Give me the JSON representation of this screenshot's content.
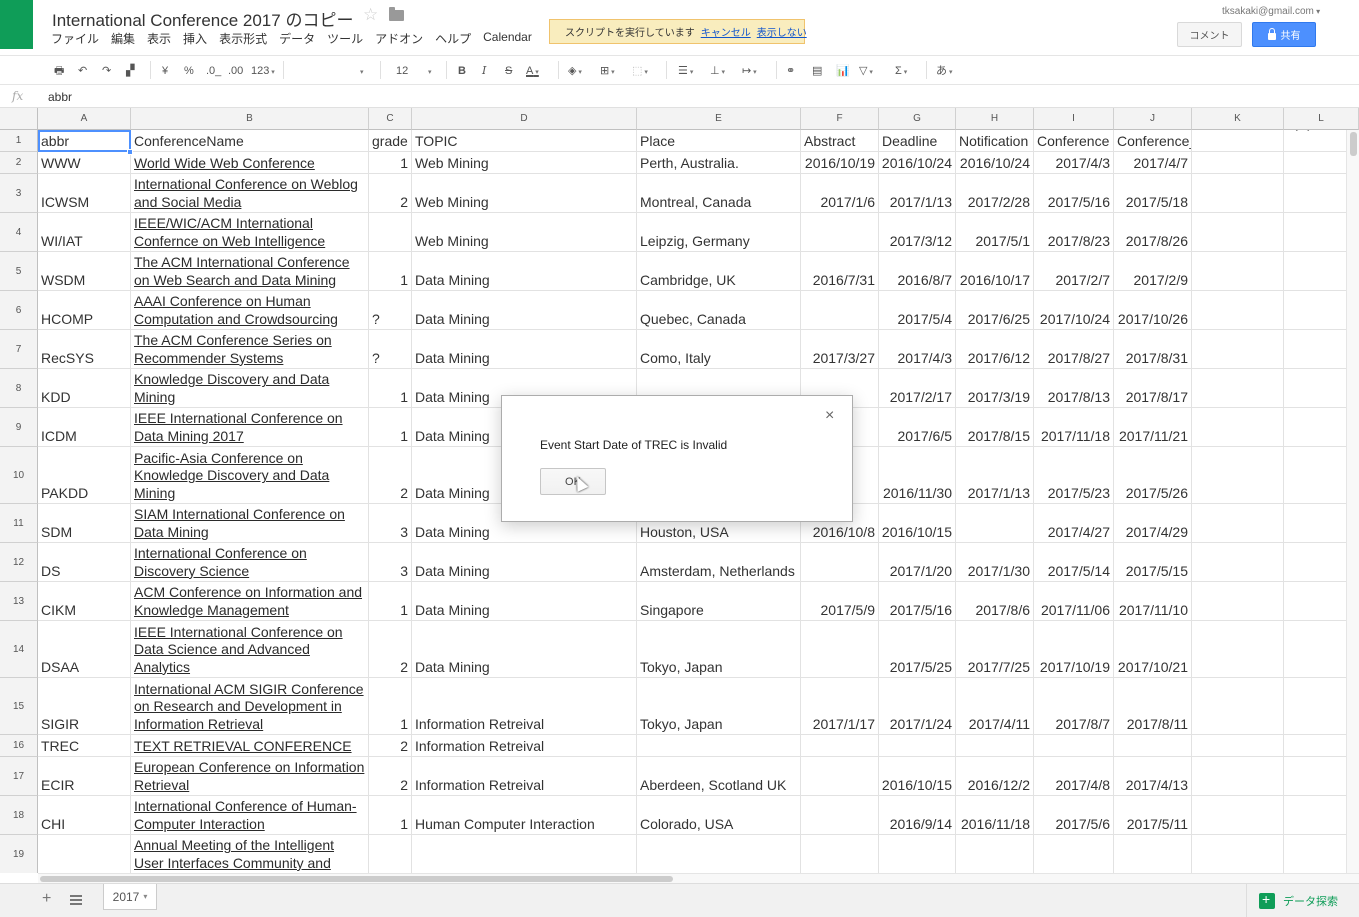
{
  "document": {
    "title": "International Conference 2017 のコピー",
    "user_email": "tksakaki@gmail.com"
  },
  "menu": [
    "ファイル",
    "編集",
    "表示",
    "挿入",
    "表示形式",
    "データ",
    "ツール",
    "アドオン",
    "ヘルプ",
    "Calendar"
  ],
  "banner": {
    "text": "スクリプトを実行しています",
    "cancel": "キャンセル",
    "hide": "表示しない"
  },
  "header_buttons": {
    "comment": "コメント",
    "share": "共有"
  },
  "toolbar": {
    "currency": "¥",
    "percent": "%",
    "dec_decrease": ".0_",
    "dec_increase": ".00",
    "format_more": "123",
    "font_size": "12",
    "bold": "B",
    "italic": "I",
    "strike": "S",
    "text_color": "A",
    "sigma": "Σ",
    "input_tools": "あ"
  },
  "formula": {
    "label": "fx",
    "value": "abbr"
  },
  "columns": [
    "A",
    "B",
    "C",
    "D",
    "E",
    "F",
    "G",
    "H",
    "I",
    "J",
    "K",
    "L"
  ],
  "rows": [
    {
      "num": "1",
      "abbr": "abbr",
      "name": "ConferenceName",
      "grade": "grade",
      "topic": "TOPIC",
      "place": "Place",
      "abstract": "Abstract",
      "deadline": "Deadline",
      "notification": "Notification",
      "conf": "Conference",
      "conf_end": "Conference_end"
    },
    {
      "num": "2",
      "abbr": "WWW",
      "name": "World Wide Web Conference",
      "grade": "1",
      "topic": "Web Mining",
      "place": "Perth, Australia.",
      "abstract": "2016/10/19",
      "deadline": "2016/10/24",
      "notification": "2016/10/24",
      "conf": "2017/4/3",
      "conf_end": "2017/4/7"
    },
    {
      "num": "3",
      "abbr": "ICWSM",
      "name": "International Conference on Weblog and Social Media",
      "grade": "2",
      "topic": "Web Mining",
      "place": "Montreal, Canada",
      "abstract": "2017/1/6",
      "deadline": "2017/1/13",
      "notification": "2017/2/28",
      "conf": "2017/5/16",
      "conf_end": "2017/5/18"
    },
    {
      "num": "4",
      "abbr": "WI/IAT",
      "name": "IEEE/WIC/ACM International Confernce on Web Intelligence",
      "grade": "",
      "topic": "Web Mining",
      "place": "Leipzig, Germany",
      "abstract": "",
      "deadline": "2017/3/12",
      "notification": "2017/5/1",
      "conf": "2017/8/23",
      "conf_end": "2017/8/26"
    },
    {
      "num": "5",
      "abbr": "WSDM",
      "name": "The ACM International Conference on Web Search and Data Mining",
      "grade": "1",
      "topic": "Data Mining",
      "place": "Cambridge, UK",
      "abstract": "2016/7/31",
      "deadline": "2016/8/7",
      "notification": "2016/10/17",
      "conf": "2017/2/7",
      "conf_end": "2017/2/9"
    },
    {
      "num": "6",
      "abbr": "HCOMP",
      "name": "AAAI Conference on Human Computation and Crowdsourcing",
      "grade": "?",
      "topic": "Data Mining",
      "place": "Quebec, Canada",
      "abstract": "",
      "deadline": "2017/5/4",
      "notification": "2017/6/25",
      "conf": "2017/10/24",
      "conf_end": "2017/10/26"
    },
    {
      "num": "7",
      "abbr": "RecSYS",
      "name": "The ACM Conference Series on Recommender Systems",
      "grade": "?",
      "topic": "Data Mining",
      "place": "Como, Italy",
      "abstract": "2017/3/27",
      "deadline": "2017/4/3",
      "notification": "2017/6/12",
      "conf": "2017/8/27",
      "conf_end": "2017/8/31"
    },
    {
      "num": "8",
      "abbr": "KDD",
      "name": "Knowledge Discovery and Data Mining",
      "grade": "1",
      "topic": "Data Mining",
      "place": "",
      "abstract": "",
      "deadline": "2017/2/17",
      "notification": "2017/3/19",
      "conf": "2017/8/13",
      "conf_end": "2017/8/17"
    },
    {
      "num": "9",
      "abbr": "ICDM",
      "name": "IEEE International Conference on Data Mining 2017",
      "grade": "1",
      "topic": "Data Mining",
      "place": "",
      "abstract": "",
      "deadline": "2017/6/5",
      "notification": "2017/8/15",
      "conf": "2017/11/18",
      "conf_end": "2017/11/21"
    },
    {
      "num": "10",
      "abbr": "PAKDD",
      "name": "Pacific-Asia Conference on Knowledge Discovery and Data Mining",
      "grade": "2",
      "topic": "Data Mining",
      "place": "",
      "abstract": "",
      "deadline": "2016/11/30",
      "notification": "2017/1/13",
      "conf": "2017/5/23",
      "conf_end": "2017/5/26"
    },
    {
      "num": "11",
      "abbr": "SDM",
      "name": "SIAM International Conference on Data Mining",
      "grade": "3",
      "topic": "Data Mining",
      "place": "Houston, USA",
      "abstract": "2016/10/8",
      "deadline": "2016/10/15",
      "notification": "",
      "conf": "2017/4/27",
      "conf_end": "2017/4/29"
    },
    {
      "num": "12",
      "abbr": "DS",
      "name": "International Conference on Discovery Science",
      "grade": "3",
      "topic": "Data Mining",
      "place": "Amsterdam, Netherlands",
      "abstract": "",
      "deadline": "2017/1/20",
      "notification": "2017/1/30",
      "conf": "2017/5/14",
      "conf_end": "2017/5/15"
    },
    {
      "num": "13",
      "abbr": "CIKM",
      "name": "ACM Conference on Information and Knowledge Management",
      "grade": "1",
      "topic": "Data Mining",
      "place": "Singapore",
      "abstract": "2017/5/9",
      "deadline": "2017/5/16",
      "notification": "2017/8/6",
      "conf": "2017/11/06",
      "conf_end": "2017/11/10"
    },
    {
      "num": "14",
      "abbr": "DSAA",
      "name": "IEEE International Conference on Data Science and Advanced Analytics",
      "grade": "2",
      "topic": "Data Mining",
      "place": "Tokyo, Japan",
      "abstract": "",
      "deadline": "2017/5/25",
      "notification": "2017/7/25",
      "conf": "2017/10/19",
      "conf_end": "2017/10/21"
    },
    {
      "num": "15",
      "abbr": "SIGIR",
      "name": "International ACM SIGIR Conference on Research and Development in Information Retrieval",
      "grade": "1",
      "topic": "Information Retreival",
      "place": "Tokyo, Japan",
      "abstract": "2017/1/17",
      "deadline": "2017/1/24",
      "notification": "2017/4/11",
      "conf": "2017/8/7",
      "conf_end": "2017/8/11"
    },
    {
      "num": "16",
      "abbr": "TREC",
      "name": "TEXT RETRIEVAL CONFERENCE",
      "grade": "2",
      "topic": "Information Retreival",
      "place": "",
      "abstract": "",
      "deadline": "",
      "notification": "",
      "conf": "",
      "conf_end": ""
    },
    {
      "num": "17",
      "abbr": "ECIR",
      "name": "European Conference on Information Retrieval",
      "grade": "2",
      "topic": "Information Retreival",
      "place": "Aberdeen, Scotland UK",
      "abstract": "",
      "deadline": "2016/10/15",
      "notification": "2016/12/2",
      "conf": "2017/4/8",
      "conf_end": "2017/4/13"
    },
    {
      "num": "18",
      "abbr": "CHI",
      "name": "International Conference of Human-Computer Interaction",
      "grade": "1",
      "topic": "Human Computer Interaction",
      "place": "Colorado, USA",
      "abstract": "",
      "deadline": "2016/9/14",
      "notification": "2016/11/18",
      "conf": "2017/5/6",
      "conf_end": "2017/5/11"
    },
    {
      "num": "19",
      "abbr": "",
      "name": "Annual Meeting of the Intelligent User Interfaces Community and",
      "grade": "",
      "topic": "",
      "place": "",
      "abstract": "",
      "deadline": "",
      "notification": "",
      "conf": "",
      "conf_end": ""
    }
  ],
  "dialog": {
    "message": "Event Start Date of TREC is Invalid",
    "ok": "OK",
    "close": "×"
  },
  "sheets": {
    "active": "2017"
  },
  "explore": {
    "label": "データ探索"
  },
  "colors": {
    "accent": "#4d90fe",
    "brand": "#0f9d58",
    "banner_bg": "#f9edbe"
  }
}
